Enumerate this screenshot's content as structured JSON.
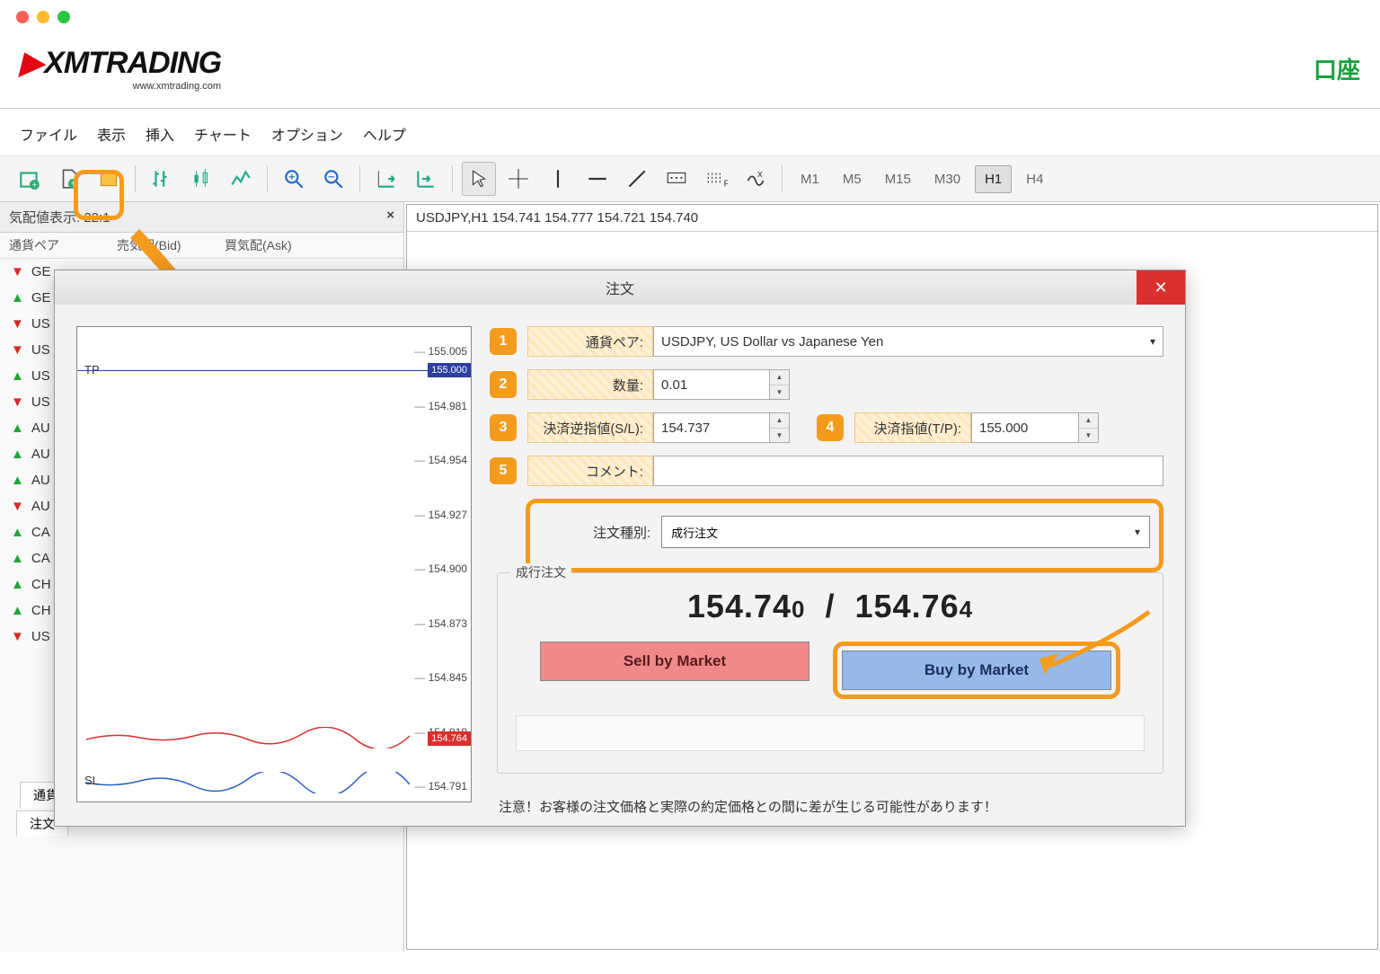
{
  "header": {
    "logo_text": "XMTRADING",
    "logo_sub": "www.xmtrading.com",
    "account_link": "口座"
  },
  "menubar": [
    "ファイル",
    "表示",
    "挿入",
    "チャート",
    "オプション",
    "ヘルプ"
  ],
  "timeframes": [
    "M1",
    "M5",
    "M15",
    "M30",
    "H1",
    "H4"
  ],
  "timeframe_active": "H1",
  "market_watch": {
    "title": "気配値表示: 22:1",
    "col_pair": "通貨ペア",
    "col_bid": "売気配(Bid)",
    "col_ask": "買気配(Ask)",
    "rows": [
      {
        "dir": "down",
        "sym": "GE"
      },
      {
        "dir": "up",
        "sym": "GE"
      },
      {
        "dir": "down",
        "sym": "US"
      },
      {
        "dir": "down",
        "sym": "US"
      },
      {
        "dir": "up",
        "sym": "US"
      },
      {
        "dir": "down",
        "sym": "US"
      },
      {
        "dir": "up",
        "sym": "AU"
      },
      {
        "dir": "up",
        "sym": "AU"
      },
      {
        "dir": "up",
        "sym": "AU"
      },
      {
        "dir": "down",
        "sym": "AU"
      },
      {
        "dir": "up",
        "sym": "CA"
      },
      {
        "dir": "up",
        "sym": "CA"
      },
      {
        "dir": "up",
        "sym": "CH"
      },
      {
        "dir": "up",
        "sym": "CH"
      },
      {
        "dir": "down",
        "sym": "US"
      }
    ],
    "tab1": "通貨",
    "tab2": "注文"
  },
  "chart": {
    "title": "USDJPY,H1  154.741 154.777 154.721 154.740"
  },
  "dialog": {
    "title": "注文",
    "mini_chart": {
      "tp_label": "TP",
      "sl_label": "SL",
      "y_ticks": [
        "155.005",
        "154.981",
        "154.954",
        "154.927",
        "154.900",
        "154.873",
        "154.845",
        "154.818",
        "154.791"
      ],
      "tp_price": "155.000",
      "ask_price": "154.764"
    },
    "fields": {
      "pair_label": "通貨ペア:",
      "pair_value": "USDJPY, US Dollar vs Japanese Yen",
      "qty_label": "数量:",
      "qty_value": "0.01",
      "sl_label": "決済逆指値(S/L):",
      "sl_value": "154.737",
      "tp_num": "4",
      "tp_label": "決済指値(T/P):",
      "tp_value": "155.000",
      "comment_label": "コメント:",
      "comment_value": ""
    },
    "order_type": {
      "label": "注文種別:",
      "value": "成行注文"
    },
    "market": {
      "legend": "成行注文",
      "bid_main": "154.74",
      "bid_sub": "0",
      "ask_main": "154.76",
      "ask_sub": "4",
      "sell_label": "Sell by Market",
      "buy_label": "Buy by Market"
    },
    "warning": "注意！お客様の注文価格と実際の約定価格との間に差が生じる可能性があります！"
  }
}
